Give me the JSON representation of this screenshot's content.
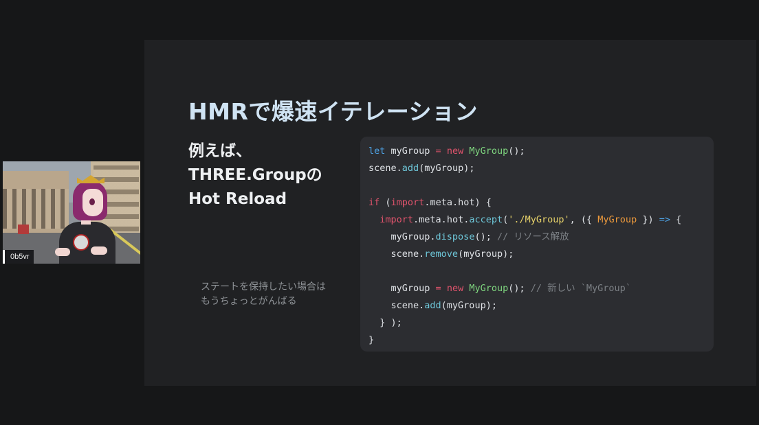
{
  "slide": {
    "title": "HMRで爆速イテレーション",
    "subtitle": [
      "例えば、",
      "THREE.Groupの",
      "Hot Reload"
    ],
    "note": [
      "ステートを保持したい場合は",
      "もうちょっとがんばる"
    ]
  },
  "code": {
    "lines": [
      [
        {
          "t": "let",
          "c": "let"
        },
        {
          "t": " myGroup ",
          "c": "txt"
        },
        {
          "t": "=",
          "c": "new"
        },
        {
          "t": " ",
          "c": "txt"
        },
        {
          "t": "new",
          "c": "new"
        },
        {
          "t": " ",
          "c": "txt"
        },
        {
          "t": "MyGroup",
          "c": "cls"
        },
        {
          "t": "();",
          "c": "txt"
        }
      ],
      [
        {
          "t": "scene.",
          "c": "txt"
        },
        {
          "t": "add",
          "c": "fn"
        },
        {
          "t": "(myGroup);",
          "c": "txt"
        }
      ],
      [],
      [
        {
          "t": "if",
          "c": "new"
        },
        {
          "t": " (",
          "c": "txt"
        },
        {
          "t": "import",
          "c": "new"
        },
        {
          "t": ".meta.hot) {",
          "c": "txt"
        }
      ],
      [
        {
          "t": "  ",
          "c": "txt"
        },
        {
          "t": "import",
          "c": "new"
        },
        {
          "t": ".meta.hot.",
          "c": "txt"
        },
        {
          "t": "accept",
          "c": "fn"
        },
        {
          "t": "(",
          "c": "txt"
        },
        {
          "t": "'./MyGroup'",
          "c": "str"
        },
        {
          "t": ", ({ ",
          "c": "txt"
        },
        {
          "t": "MyGroup",
          "c": "arg"
        },
        {
          "t": " }) ",
          "c": "txt"
        },
        {
          "t": "=>",
          "c": "arrow"
        },
        {
          "t": " {",
          "c": "txt"
        }
      ],
      [
        {
          "t": "    myGroup.",
          "c": "txt"
        },
        {
          "t": "dispose",
          "c": "fn"
        },
        {
          "t": "(); ",
          "c": "txt"
        },
        {
          "t": "// リソース解放",
          "c": "cmt"
        }
      ],
      [
        {
          "t": "    scene.",
          "c": "txt"
        },
        {
          "t": "remove",
          "c": "fn"
        },
        {
          "t": "(myGroup);",
          "c": "txt"
        }
      ],
      [],
      [
        {
          "t": "    myGroup ",
          "c": "txt"
        },
        {
          "t": "=",
          "c": "new"
        },
        {
          "t": " ",
          "c": "txt"
        },
        {
          "t": "new",
          "c": "new"
        },
        {
          "t": " ",
          "c": "txt"
        },
        {
          "t": "MyGroup",
          "c": "cls"
        },
        {
          "t": "(); ",
          "c": "txt"
        },
        {
          "t": "// 新しい `MyGroup`",
          "c": "cmt"
        }
      ],
      [
        {
          "t": "    scene.",
          "c": "txt"
        },
        {
          "t": "add",
          "c": "fn"
        },
        {
          "t": "(myGroup);",
          "c": "txt"
        }
      ],
      [
        {
          "t": "  } );",
          "c": "txt"
        }
      ],
      [
        {
          "t": "}",
          "c": "txt"
        }
      ]
    ]
  },
  "webcam": {
    "label": "0b5vr"
  }
}
